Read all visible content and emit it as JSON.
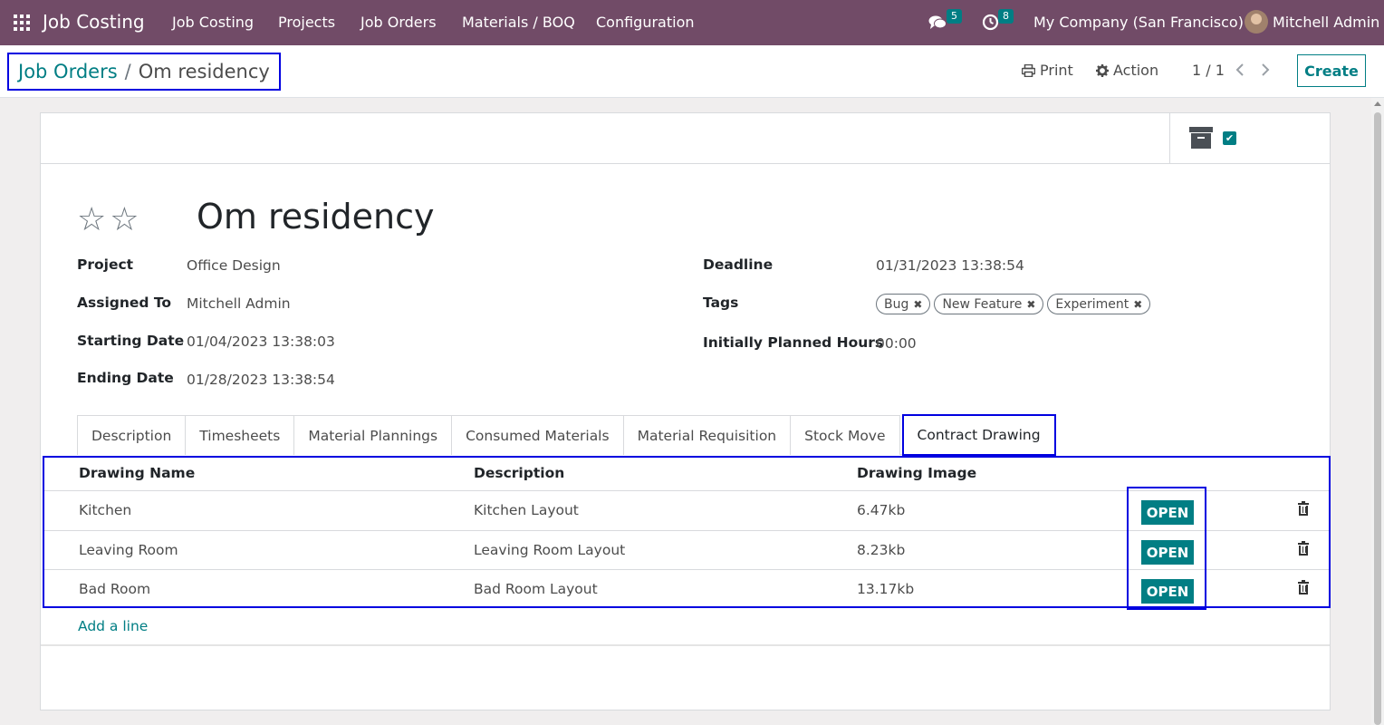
{
  "navbar": {
    "app_title": "Job Costing",
    "menu": [
      "Job Costing",
      "Projects",
      "Job Orders",
      "Materials / BOQ",
      "Configuration"
    ],
    "messages_count": "5",
    "activities_count": "8",
    "company": "My Company (San Francisco)",
    "user": "Mitchell Admin"
  },
  "breadcrumb": {
    "parent": "Job Orders",
    "separator": "/",
    "current": "Om residency"
  },
  "control_panel": {
    "print_label": "Print",
    "action_label": "Action",
    "pager": "1 / 1",
    "create_label": "Create"
  },
  "record": {
    "title": "Om residency",
    "stars": "☆☆",
    "fields_left": [
      {
        "label": "Project",
        "value": "Office Design"
      },
      {
        "label": "Assigned To",
        "value": "Mitchell Admin"
      },
      {
        "label": "Starting Date",
        "value": "01/04/2023 13:38:03"
      },
      {
        "label": "Ending Date",
        "value": "01/28/2023 13:38:54"
      }
    ],
    "fields_right": [
      {
        "label": "Deadline",
        "value": "01/31/2023 13:38:54"
      },
      {
        "label": "Tags",
        "value": ""
      },
      {
        "label": "Initially Planned Hours",
        "value": "00:00"
      }
    ],
    "tags": [
      "Bug",
      "New Feature",
      "Experiment"
    ]
  },
  "tabs": [
    "Description",
    "Timesheets",
    "Material Plannings",
    "Consumed Materials",
    "Material Requisition",
    "Stock Move",
    "Contract Drawing"
  ],
  "drawings": {
    "columns": [
      "Drawing Name",
      "Description",
      "Drawing Image"
    ],
    "rows": [
      {
        "name": "Kitchen",
        "description": "Kitchen Layout",
        "image": "6.47kb",
        "action": "OPEN"
      },
      {
        "name": "Leaving Room",
        "description": "Leaving Room Layout",
        "image": "8.23kb",
        "action": "OPEN"
      },
      {
        "name": "Bad Room",
        "description": "Bad Room Layout",
        "image": "13.17kb",
        "action": "OPEN"
      }
    ],
    "add_line": "Add a line"
  },
  "colors": {
    "navbar": "#714b67",
    "accent": "#017e84",
    "highlight": "#0000e0"
  },
  "icons": [
    "apps-grid-icon",
    "chat-icon",
    "clock-icon",
    "print-icon",
    "gear-icon",
    "chevron-left-icon",
    "chevron-right-icon",
    "archive-icon",
    "check-icon",
    "star-icon",
    "trash-icon",
    "tag-remove-icon"
  ]
}
